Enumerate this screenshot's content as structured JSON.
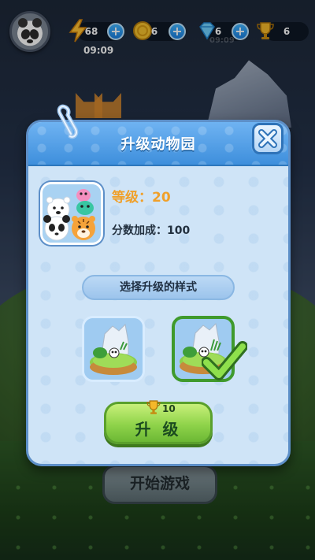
{
  "hud": {
    "energy": {
      "value": "68",
      "icon": "lightning-icon"
    },
    "coins": {
      "value": "6",
      "icon": "coin-icon"
    },
    "gems": {
      "value": "6",
      "icon": "diamond-icon"
    },
    "trophies": {
      "value": "6",
      "icon": "trophy-icon"
    },
    "timer": "09:09",
    "ghost_timer": "09:09"
  },
  "dialog": {
    "title": "升级动物园",
    "level_label": "等级：20",
    "bonus_label": "分数加成：100",
    "choose_style_label": "选择升级的样式",
    "selected_style": 2,
    "upgrade_button_label": "升 级",
    "upgrade_cost": "10"
  },
  "background": {
    "start_button_label": "开始游戏"
  },
  "colors": {
    "header_blue": "#3e8fdc",
    "panel_bg": "#cfe4f7",
    "level_orange": "#f0a02a",
    "button_green": "#8fd34a"
  }
}
